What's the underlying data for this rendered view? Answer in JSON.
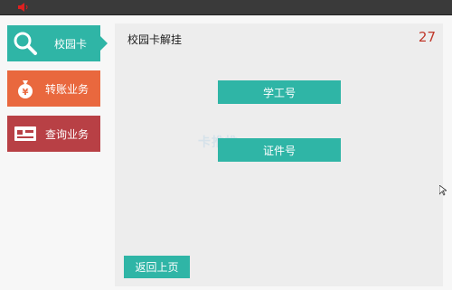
{
  "topbar": {
    "icon": "speaker-icon",
    "icon_color": "#e02020"
  },
  "nav": {
    "items": [
      {
        "label": "校园卡",
        "icon": "search-icon",
        "color": "#2fb5a6"
      },
      {
        "label": "转账业务",
        "icon": "money-bag-icon",
        "color": "#e9683e"
      },
      {
        "label": "查询业务",
        "icon": "card-icon",
        "color": "#b84045"
      }
    ]
  },
  "panel": {
    "title": "校园卡解挂",
    "countdown": "27",
    "watermark": "卡推推"
  },
  "buttons": {
    "student_no": "学工号",
    "id_no": "证件号",
    "back": "返回上页"
  },
  "colors": {
    "accent": "#2fb5a6",
    "countdown": "#c0392b"
  }
}
